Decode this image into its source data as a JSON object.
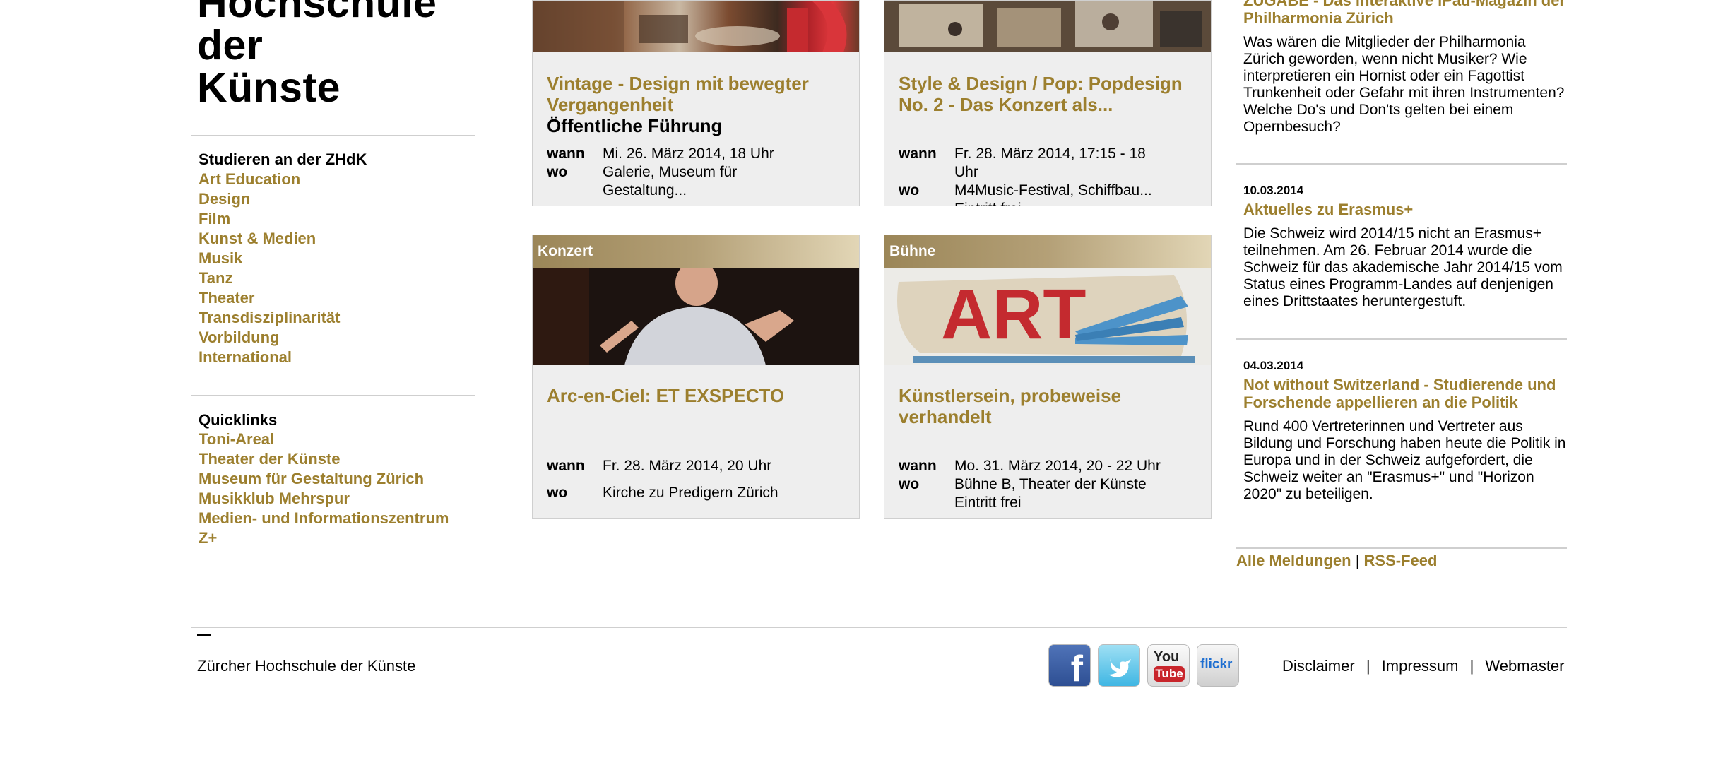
{
  "logo": {
    "lines": [
      "Hochschule",
      "der",
      "Künste"
    ]
  },
  "study_nav": {
    "title": "Studieren an der ZHdK",
    "items": [
      "Art Education",
      "Design",
      "Film",
      "Kunst & Medien",
      "Musik",
      "Tanz",
      "Theater",
      "Transdisziplinarität",
      "Vorbildung",
      "International"
    ]
  },
  "quicklinks": {
    "title": "Quicklinks",
    "items": [
      "Toni-Areal",
      "Theater der Künste",
      "Museum für Gestaltung Zürich",
      "Musikklub Mehrspur",
      "Medien- und Informationszentrum",
      "Z+"
    ]
  },
  "labels": {
    "wann": "wann",
    "wo": "wo"
  },
  "cards": [
    {
      "title": "Vintage - Design mit bewegter Vergangenheit",
      "subtitle": "Öffentliche Führung",
      "wann": "Mi. 26. März 2014, 18 Uhr",
      "wo": "Galerie, Museum für Gestaltung..."
    },
    {
      "title": "Style & Design / Pop: Popdesign No. 2 - Das Konzert als...",
      "wann": "Fr. 28. März 2014, 17:15 - 18 Uhr",
      "wo": "M4Music-Festival, Schiffbau...",
      "extra": "Eintritt frei"
    },
    {
      "category": "Konzert",
      "title": "Arc-en-Ciel: ET EXSPECTO",
      "wann": "Fr. 28. März 2014, 20 Uhr",
      "wo": "Kirche zu Predigern Zürich"
    },
    {
      "category": "Bühne",
      "title": "Künstlersein, probeweise verhandelt",
      "wann": "Mo. 31. März 2014, 20 - 22 Uhr",
      "wo": "Bühne B, Theater der Künste",
      "extra": "Eintritt frei",
      "image_text": "ART"
    }
  ],
  "news": [
    {
      "title": "ZUGABE - Das interaktive iPad-Magazin der Philharmonia Zürich",
      "text": "Was wären die Mitglieder der Philharmonia Zürich geworden, wenn nicht Musiker? Wie interpretieren ein Hornist oder ein Fagottist Trunkenheit oder Gefahr mit ihren Instrumenten? Welche Do's und Don'ts gelten bei einem Opernbesuch?"
    },
    {
      "date": "10.03.2014",
      "title": "Aktuelles zu Erasmus+",
      "text": "Die Schweiz wird 2014/15 nicht an Erasmus+ teilnehmen. Am 26. Februar 2014 wurde die Schweiz für das akademische Jahr 2014/15 vom Status eines Programm-Landes auf denjenigen eines Drittstaates heruntergestuft."
    },
    {
      "date": "04.03.2014",
      "title": "Not without Switzerland - Studierende und Forschende appellieren an die Politik",
      "text": "Rund 400 Vertreterinnen und Vertreter aus Bildung und Forschung haben heute die Politik in Europa und in der Schweiz aufgefordert, die Schweiz weiter an \"Erasmus+\" und \"Horizon 2020\" zu beteiligen."
    }
  ],
  "news_links": {
    "all": "Alle Meldungen",
    "sep": "|",
    "rss": "RSS-Feed"
  },
  "footer": {
    "dash": "—",
    "name": "Zürcher Hochschule der Künste",
    "social": {
      "facebook": "f",
      "youtube_you": "You",
      "youtube_tube": "Tube",
      "flickr": "flickr"
    },
    "links": [
      "Disclaimer",
      "Impressum",
      "Webmaster"
    ],
    "sep": "|"
  },
  "colors": {
    "accent": "#9c7f2e",
    "band_start": "#9b8658",
    "band_end": "#e2d6b6",
    "card_bg": "#eeeeee"
  }
}
